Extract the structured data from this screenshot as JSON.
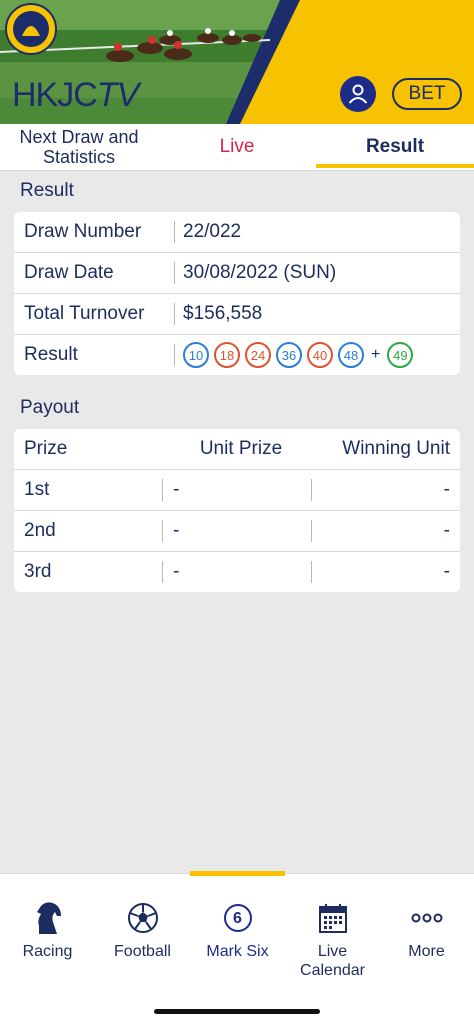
{
  "header": {
    "logo_main": "HKJC",
    "logo_tv": "TV",
    "bet_label": "BET"
  },
  "tabs": [
    {
      "label": "Next Draw and Statistics"
    },
    {
      "label": "Live"
    },
    {
      "label": "Result"
    }
  ],
  "result": {
    "title": "Result",
    "rows": [
      {
        "label": "Draw Number",
        "value": "22/022"
      },
      {
        "label": "Draw Date",
        "value": "30/08/2022 (SUN)"
      },
      {
        "label": "Total Turnover",
        "value": "$156,558"
      },
      {
        "label": "Result"
      }
    ],
    "balls": [
      {
        "n": "10",
        "color": "#2a7fd4"
      },
      {
        "n": "18",
        "color": "#e0522d"
      },
      {
        "n": "24",
        "color": "#e0522d"
      },
      {
        "n": "36",
        "color": "#2a7fd4"
      },
      {
        "n": "40",
        "color": "#e0522d"
      },
      {
        "n": "48",
        "color": "#2a7fd4"
      }
    ],
    "plus": "+",
    "extra_ball": {
      "n": "49",
      "color": "#2ea843"
    }
  },
  "payout": {
    "title": "Payout",
    "headers": [
      "Prize",
      "Unit Prize",
      "Winning Unit"
    ],
    "rows": [
      {
        "prize": "1st",
        "unit_prize": "-",
        "winning_unit": "-"
      },
      {
        "prize": "2nd",
        "unit_prize": "-",
        "winning_unit": "-"
      },
      {
        "prize": "3rd",
        "unit_prize": "-",
        "winning_unit": "-"
      }
    ]
  },
  "bottom_nav": [
    {
      "label": "Racing",
      "icon": "horse-icon"
    },
    {
      "label": "Football",
      "icon": "football-icon"
    },
    {
      "label": "Mark Six",
      "icon": "mark-six-icon",
      "icon_text": "6"
    },
    {
      "label": "Live Calendar",
      "icon": "calendar-icon"
    },
    {
      "label": "More",
      "icon": "more-icon"
    }
  ],
  "colors": {
    "brand_yellow": "#f7c300",
    "brand_navy": "#1d2c6b",
    "live_red": "#d6264b"
  }
}
